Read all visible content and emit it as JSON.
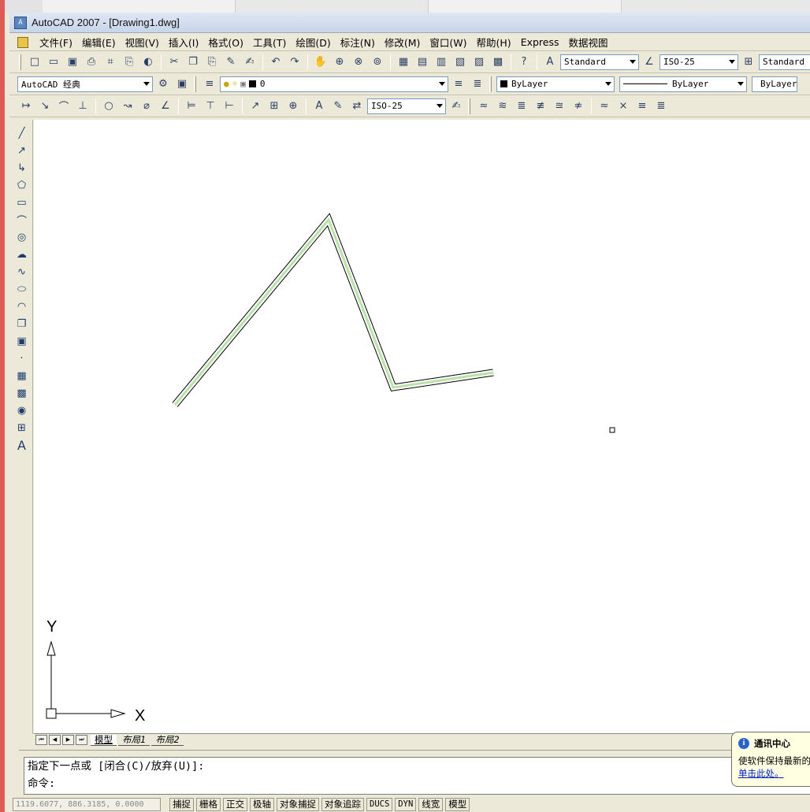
{
  "window": {
    "title": "AutoCAD 2007 - [Drawing1.dwg]",
    "app_icon_text": "A"
  },
  "menu": {
    "items": [
      "文件(F)",
      "编辑(E)",
      "视图(V)",
      "插入(I)",
      "格式(O)",
      "工具(T)",
      "绘图(D)",
      "标注(N)",
      "修改(M)",
      "窗口(W)",
      "帮助(H)",
      "Express",
      "数据视图"
    ]
  },
  "standard_toolbar": {
    "text_style": "Standard",
    "dim_style": "ISO-25",
    "table_style": "Standard"
  },
  "workspace_toolbar": {
    "workspace": "AutoCAD 经典",
    "layer": "0",
    "color": "ByLayer",
    "linetype": "ByLayer",
    "lineweight": "ByLayer"
  },
  "dimension_toolbar": {
    "dim_style": "ISO-25"
  },
  "ucs": {
    "y_label": "Y",
    "x_label": "X"
  },
  "layout_tabs": [
    "模型",
    "布局1",
    "布局2"
  ],
  "command": {
    "prompt_line": "指定下一点或 [闭合(C)/放弃(U)]:",
    "input_line": "命令:"
  },
  "status": {
    "coords": "1119.6077, 886.3185, 0.0000",
    "buttons": [
      "捕捉",
      "栅格",
      "正交",
      "极轴",
      "对象捕捉",
      "对象追踪",
      "DUCS",
      "DYN",
      "线宽",
      "模型"
    ]
  },
  "balloon": {
    "title": "通讯中心",
    "message": "使软件保持最新的",
    "link": "单击此处。"
  },
  "colors": {
    "polyline_fill": "#b7e3a6",
    "window_accent": "#e05a55"
  }
}
